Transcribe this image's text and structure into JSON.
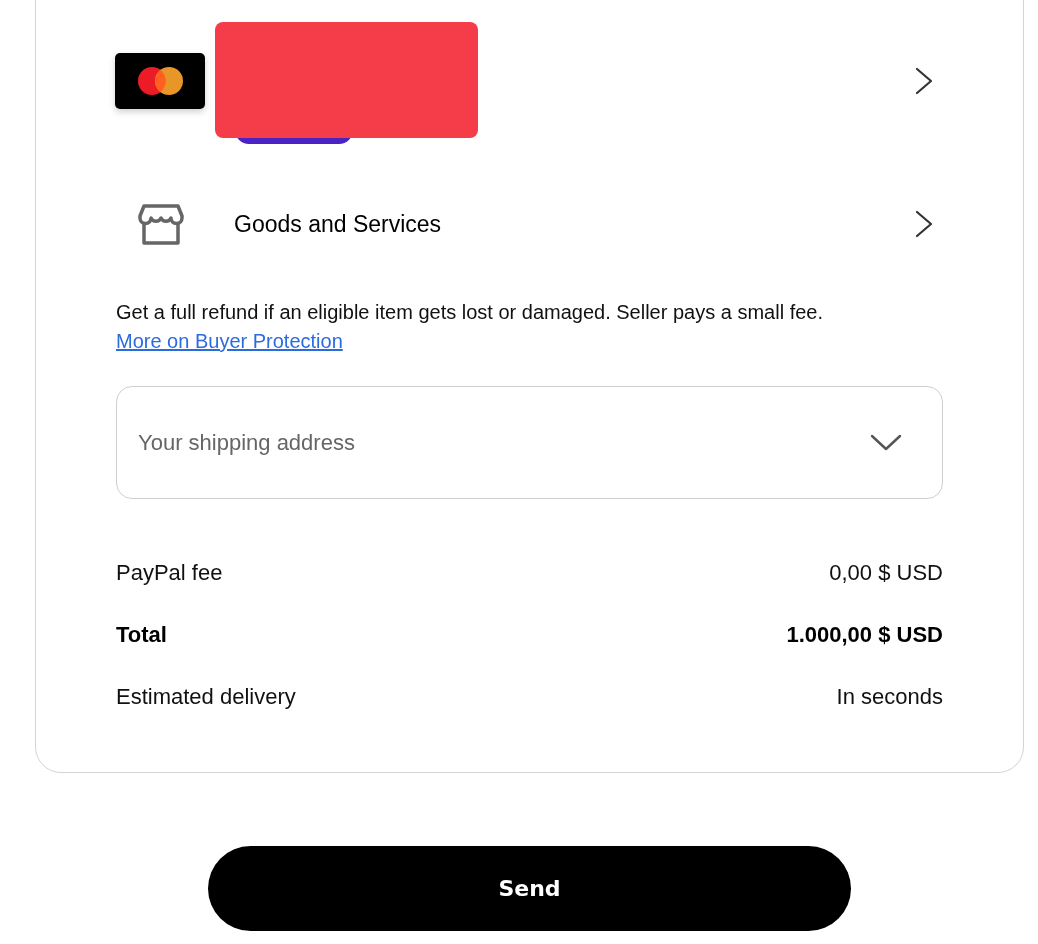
{
  "payment_method": {
    "redacted": true
  },
  "protection": {
    "label": "Goods and Services",
    "description": "Get a full refund if an eligible item gets lost or damaged. Seller pays a small fee.",
    "link": "More on Buyer Protection"
  },
  "shipping_address": {
    "placeholder": "Your shipping address"
  },
  "summary": [
    {
      "kind": "line",
      "label": "PayPal fee",
      "value": "0,00 $ USD"
    },
    {
      "kind": "total",
      "label": "Total",
      "value": "1.000,00 $ USD"
    },
    {
      "kind": "line",
      "label": "Estimated delivery",
      "value": "In seconds"
    }
  ],
  "send_button": {
    "label": "Send"
  }
}
